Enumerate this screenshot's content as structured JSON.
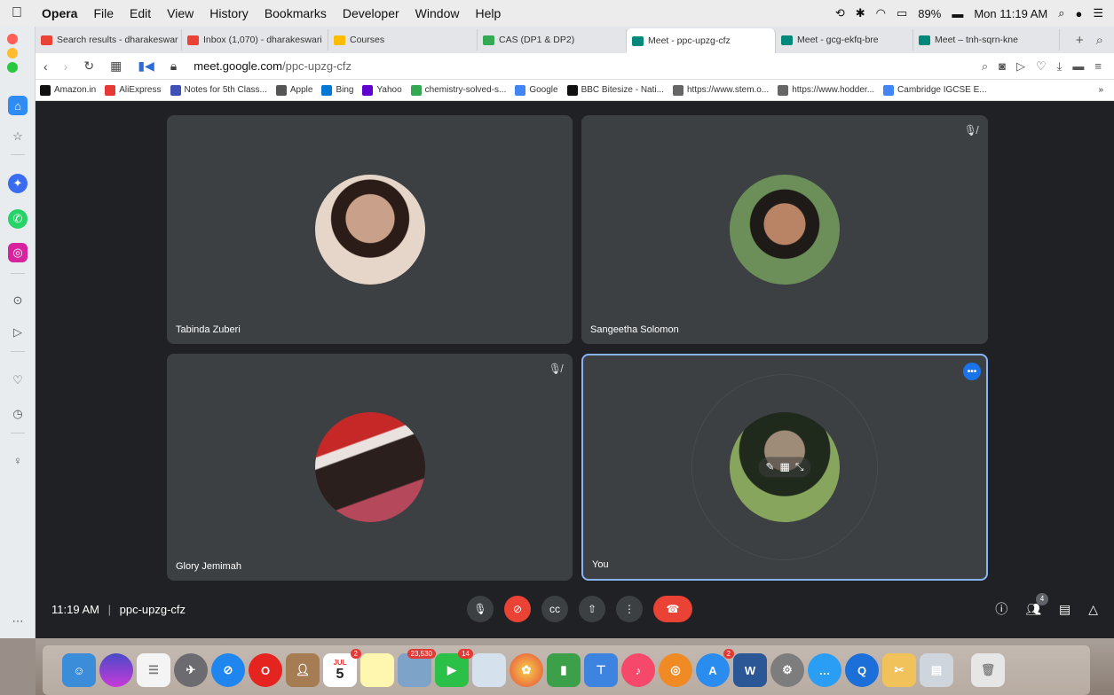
{
  "menubar": {
    "app_name": "Opera",
    "items": [
      "File",
      "Edit",
      "View",
      "History",
      "Bookmarks",
      "Developer",
      "Window",
      "Help"
    ],
    "battery": "89%",
    "clock": "Mon 11:19 AM"
  },
  "tabs": [
    {
      "label": "Search results - dharakeswar",
      "color": "#ea4335"
    },
    {
      "label": "Inbox (1,070) - dharakeswari",
      "color": "#ea4335"
    },
    {
      "label": "Courses",
      "color": "#fbbc04"
    },
    {
      "label": "CAS (DP1 & DP2)",
      "color": "#34a853"
    },
    {
      "label": "Meet - ppc-upzg-cfz",
      "color": "#00897b"
    },
    {
      "label": "Meet - gcg-ekfq-bre",
      "color": "#00897b"
    },
    {
      "label": "Meet – tnh-sqrn-kne",
      "color": "#00897b"
    }
  ],
  "address": {
    "url_domain": "meet.google.com",
    "url_path": "/ppc-upzg-cfz"
  },
  "bookmarks": [
    {
      "label": "Amazon.in",
      "color": "#111"
    },
    {
      "label": "AliExpress",
      "color": "#e53935"
    },
    {
      "label": "Notes for 5th Class...",
      "color": "#3f51b5"
    },
    {
      "label": "Apple",
      "color": "#555"
    },
    {
      "label": "Bing",
      "color": "#0078d4"
    },
    {
      "label": "Yahoo",
      "color": "#6001d2"
    },
    {
      "label": "chemistry-solved-s...",
      "color": "#34a853"
    },
    {
      "label": "Google",
      "color": "#4285f4"
    },
    {
      "label": "BBC Bitesize - Nati...",
      "color": "#111"
    },
    {
      "label": "https://www.stem.o...",
      "color": "#666"
    },
    {
      "label": "https://www.hodder...",
      "color": "#666"
    },
    {
      "label": "Cambridge IGCSE E...",
      "color": "#4285f4"
    }
  ],
  "participants": [
    {
      "name": "Tabinda Zuberi",
      "muted": false
    },
    {
      "name": "Sangeetha Solomon",
      "muted": true
    },
    {
      "name": "Glory Jemimah",
      "muted": true
    },
    {
      "name": "You",
      "muted": false
    }
  ],
  "meeting": {
    "time": "11:19 AM",
    "separator": "|",
    "code": "ppc-upzg-cfz",
    "people_count": "4"
  },
  "dock": {
    "calendar_date": "5",
    "calendar_month": "JUL",
    "calendar_badge": "2",
    "photos_badge": "23,530",
    "facetime_badge": "14",
    "appstore_badge": "2"
  }
}
